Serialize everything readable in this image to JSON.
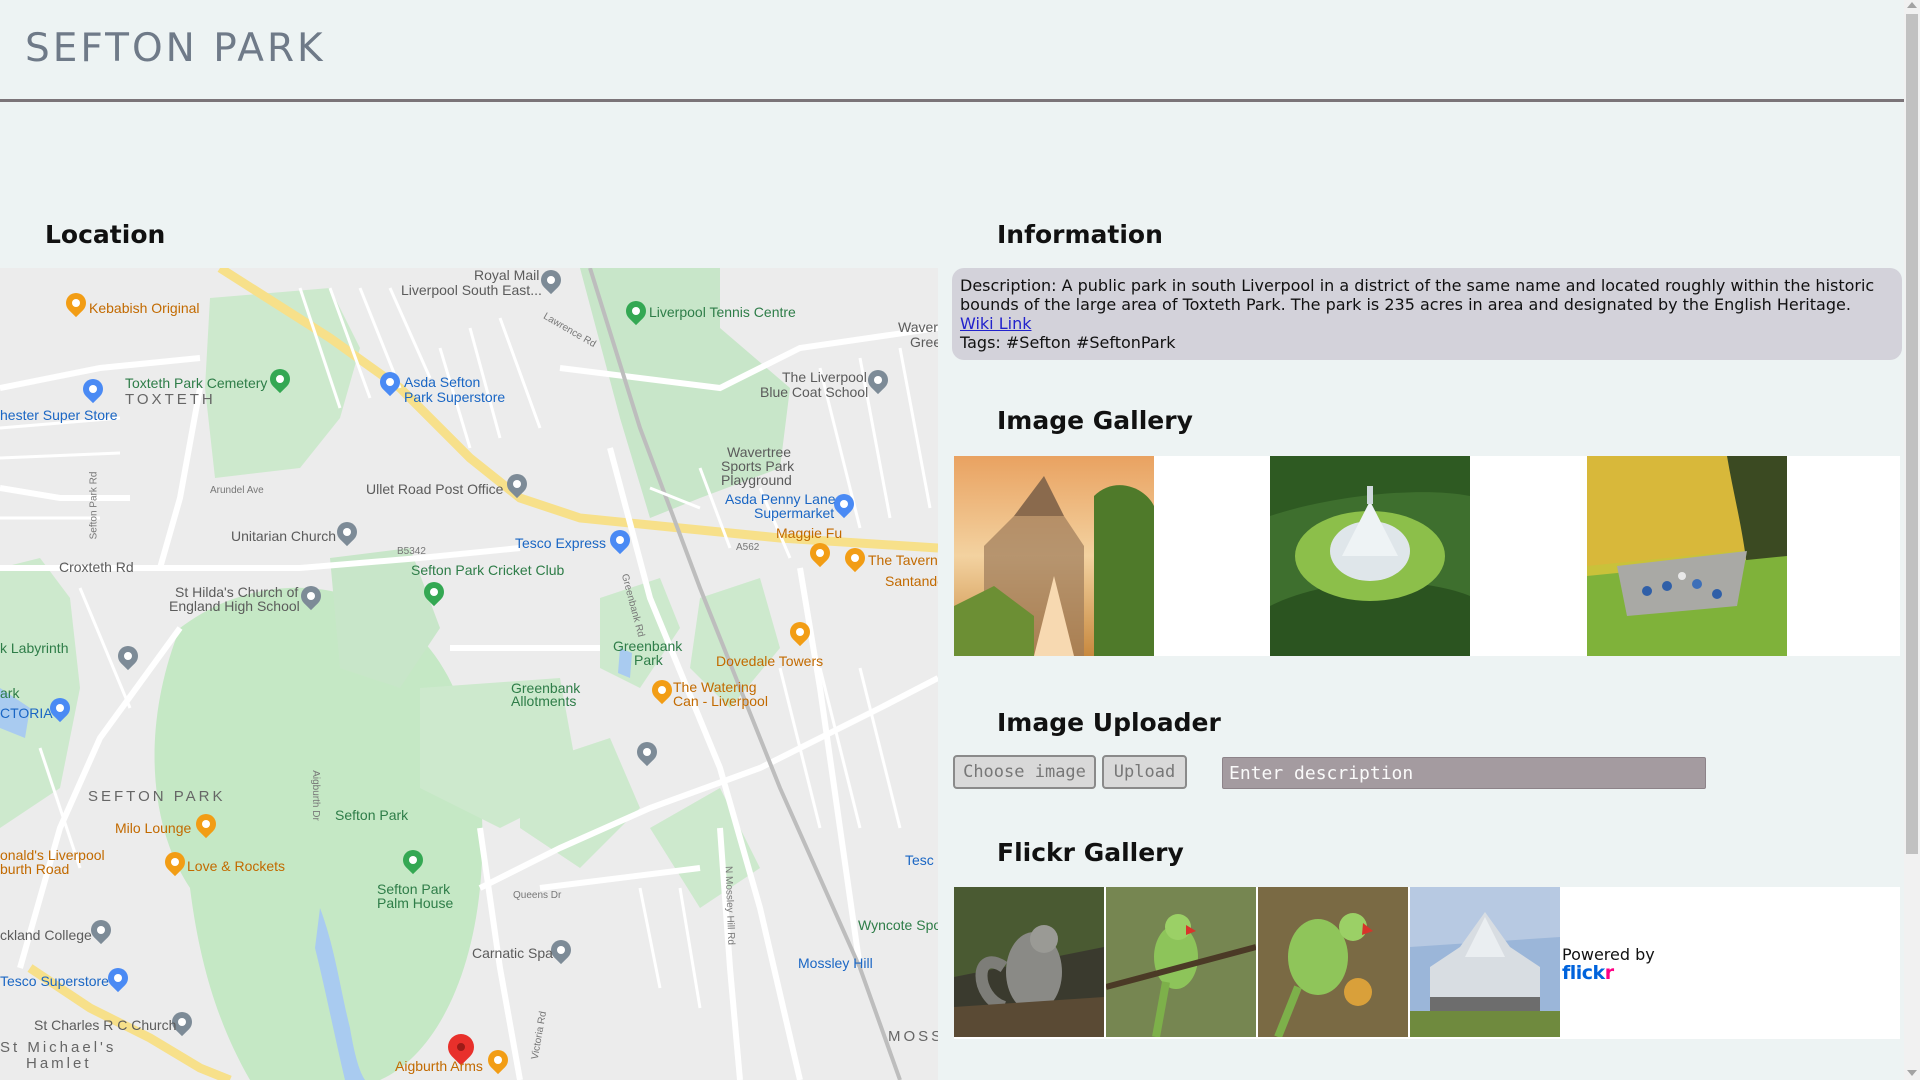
{
  "header": {
    "title": "SEFTON PARK"
  },
  "location": {
    "heading": "Location"
  },
  "map": {
    "labels": {
      "royal_mail": "Royal Mail",
      "liverpool_south_east": "Liverpool South East...",
      "kebabish": "Kebabish Original",
      "tennis": "Liverpool Tennis Centre",
      "waver": "Waver",
      "gree": "Gree",
      "toxteth_cemetery": "Toxteth Park Cemetery",
      "toxteth": "TOXTETH",
      "asda_sefton": "Asda Sefton",
      "park_superstore": "Park Superstore",
      "bluecoat1": "The Liverpool",
      "bluecoat2": "Blue Coat School",
      "hester": "hester Super Store",
      "wavertree1": "Wavertree",
      "wavertree2": "Sports Park",
      "wavertree3": "Playground",
      "ullet": "Ullet Road Post Office",
      "asda_penny1": "Asda Penny Lane",
      "asda_penny2": "Supermarket",
      "unitarian": "Unitarian Church",
      "tesco_express": "Tesco Express",
      "maggie": "Maggie Fu",
      "tavern": "The Tavern",
      "santande": "Santande",
      "cricket": "Sefton Park Cricket Club",
      "st_hilda1": "St Hilda's Church of",
      "st_hilda2": "England High School",
      "croxteth_rd": "Croxteth Rd",
      "greenbank_park1": "Greenbank",
      "greenbank_park2": "Park",
      "dovedale": "Dovedale Towers",
      "labyrinth": "k Labyrinth",
      "greenbank_allot1": "Greenbank",
      "greenbank_allot2": "Allotments",
      "watering1": "The Watering",
      "watering2": "Can - Liverpool",
      "ark": "ark",
      "ctoria": "CTORIA",
      "sefton_park_area": "SEFTON PARK",
      "sefton_park": "Sefton Park",
      "milo": "Milo Lounge",
      "mcdonalds1": "onald's Liverpool",
      "mcdonalds2": "burth Road",
      "love_rockets": "Love & Rockets",
      "palm1": "Sefton Park",
      "palm2": "Palm House",
      "tesc": "Tesc",
      "wyncote": "Wyncote Spo",
      "college": "ckland College",
      "carnatic": "Carnatic Spa",
      "tesco_superstore": "Tesco Superstore",
      "mossley": "Mossley Hill",
      "st_charles": "St Charles R C Church",
      "st_michaels1": "St Michael's",
      "st_michaels2": "Hamlet",
      "aigburth_arms": "Aigburth Arms",
      "moss": "MOSS",
      "a562": "A562",
      "b5342": "B5342",
      "queens_dr": "Queens Dr",
      "aigburth_dr": "Aigburth Dr",
      "greenbank_rd": "Greenbank Rd",
      "mossley_hill_rd": "N Mossley Hill Rd",
      "victoria_rd": "Victoria Rd",
      "sefton_park_rd": "Sefton Park Rd",
      "lawrence_rd": "Lawrence Rd",
      "arundel_ave": "Arundel Ave"
    }
  },
  "information": {
    "heading": "Information",
    "description": "Description: A public park in south Liverpool in a district of the same name and located roughly within the historic bounds of the large area of Toxteth Park. The park is 235 acres in area and designated by the English Heritage.",
    "wiki_link": "Wiki Link",
    "tags": "Tags: #Sefton #SeftonPark"
  },
  "image_gallery": {
    "heading": "Image Gallery"
  },
  "image_uploader": {
    "heading": "Image Uploader",
    "choose_label": "Choose image",
    "upload_label": "Upload",
    "description_placeholder": "Enter description"
  },
  "flickr_gallery": {
    "heading": "Flickr Gallery",
    "powered_by": "Powered by",
    "logo_part1": "flick",
    "logo_part2": "r"
  },
  "colors": {
    "background": "#edf3f3",
    "title": "#6f7a88",
    "info_box": "#d3d2da",
    "input_bg": "#a49ba0",
    "park_green": "#c5e8c5"
  }
}
